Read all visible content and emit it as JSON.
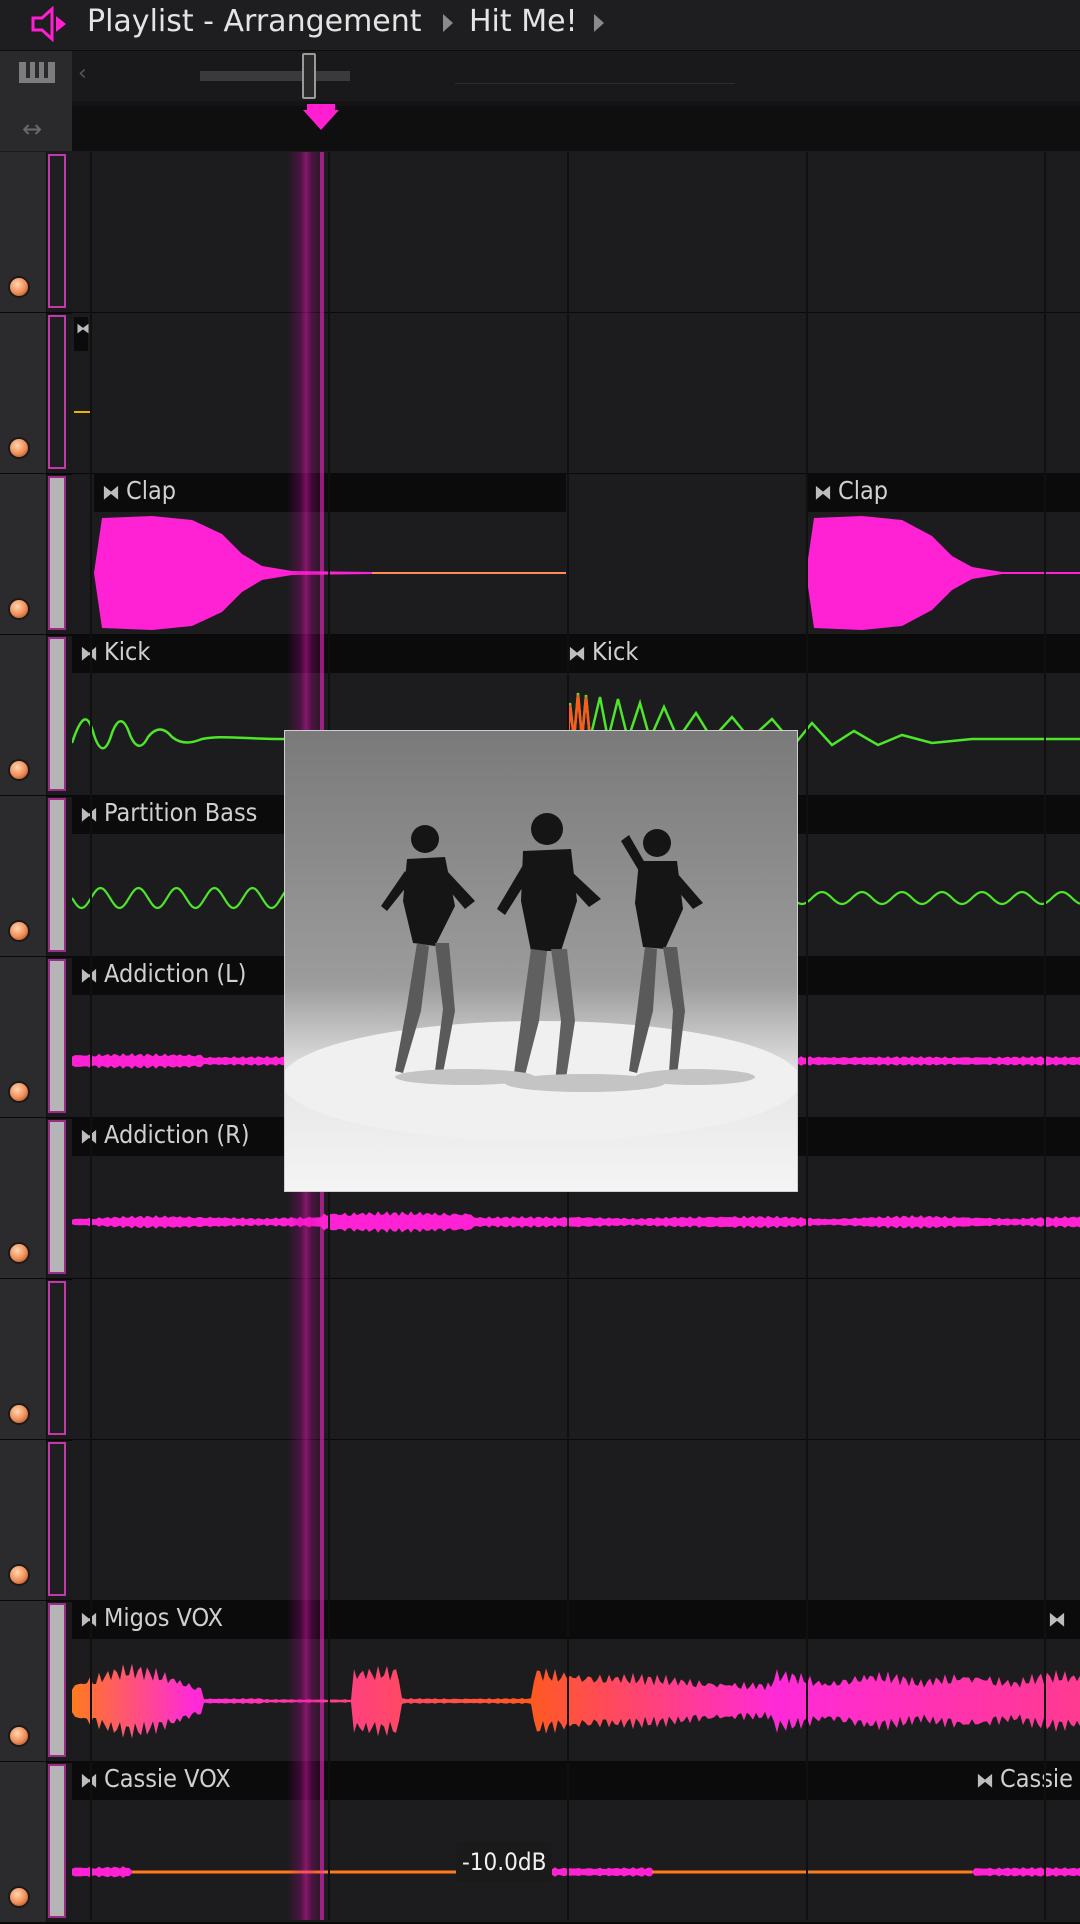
{
  "title": {
    "window": "Playlist - Arrangement",
    "pattern": "Hit Me!"
  },
  "tracks": [
    {
      "name": "",
      "clips": []
    },
    {
      "name": "",
      "clips": []
    },
    {
      "name": "Clap",
      "clips": [
        {
          "label": "Clap"
        },
        {
          "label": "Clap"
        }
      ]
    },
    {
      "name": "Kick",
      "clips": [
        {
          "label": "Kick"
        },
        {
          "label": "Kick"
        }
      ]
    },
    {
      "name": "Partition Bass",
      "clips": [
        {
          "label": "Partition Bass"
        }
      ]
    },
    {
      "name": "Addiction (L)",
      "clips": [
        {
          "label": "Addiction (L)"
        }
      ]
    },
    {
      "name": "Addiction (R)",
      "clips": [
        {
          "label": "Addiction (R)"
        }
      ]
    },
    {
      "name": "",
      "clips": []
    },
    {
      "name": "",
      "clips": []
    },
    {
      "name": "Migos VOX",
      "clips": [
        {
          "label": "Migos VOX"
        }
      ]
    },
    {
      "name": "Cassie VOX",
      "clips": [
        {
          "label": "Cassie VOX"
        },
        {
          "label": "Cassie"
        }
      ]
    }
  ],
  "volume_readout": "-10.0dB",
  "icons": {
    "logo": "fl-speaker-icon",
    "piano": "piano-keys-icon",
    "stretch": "stretch-arrows-icon",
    "clip_pin": "clip-pin-icon",
    "track_led": "track-led-icon"
  },
  "colors": {
    "accent": "#ff1ed0",
    "wave_pink": "#ff2ad8",
    "wave_green": "#4ee62a",
    "wave_orange": "#ff6a1e"
  }
}
